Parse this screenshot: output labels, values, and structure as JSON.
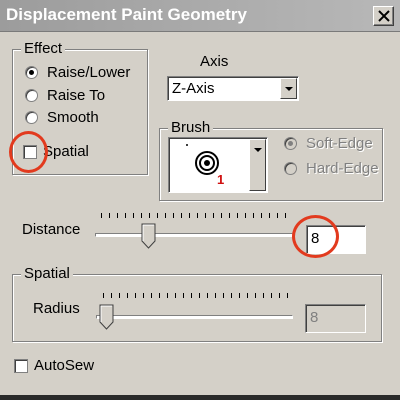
{
  "window": {
    "title": "Displacement Paint Geometry",
    "close_label": "×"
  },
  "effect": {
    "title": "Effect",
    "options": [
      {
        "label": "Raise/Lower",
        "checked": true
      },
      {
        "label": "Raise To",
        "checked": false
      },
      {
        "label": "Smooth",
        "checked": false
      }
    ],
    "spatial_checkbox": {
      "label": "Spatial",
      "checked": false
    }
  },
  "axis": {
    "label": "Axis",
    "value": "Z-Axis"
  },
  "brush": {
    "title": "Brush",
    "index_label": "1",
    "options": [
      {
        "label": "Soft-Edge",
        "checked": true,
        "disabled": true
      },
      {
        "label": "Hard-Edge",
        "checked": false,
        "disabled": true
      }
    ]
  },
  "distance": {
    "label": "Distance",
    "value": "8",
    "slider_fraction": 0.28
  },
  "spatial": {
    "title": "Spatial",
    "radius_label": "Radius",
    "radius_value": "8",
    "slider_fraction": 0.0
  },
  "autosew": {
    "label": "AutoSew",
    "checked": false
  },
  "colors": {
    "highlight": "#e23a1e",
    "brush_index": "#d01010"
  }
}
